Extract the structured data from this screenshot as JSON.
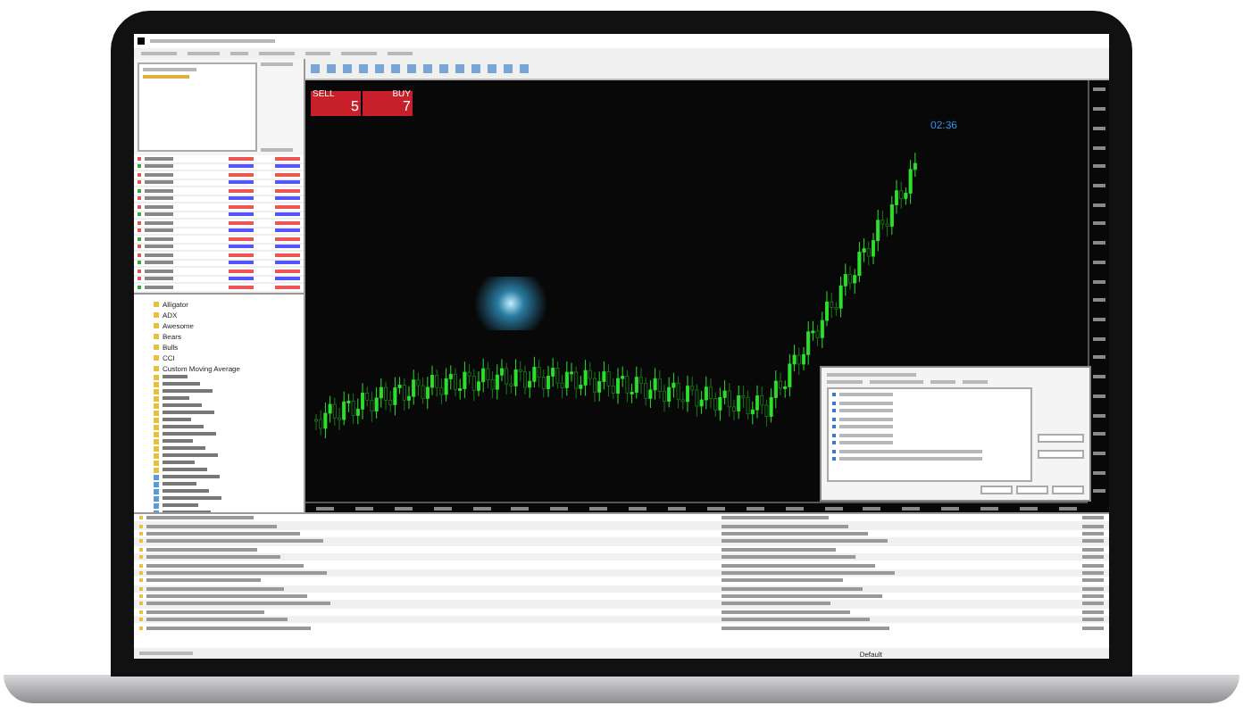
{
  "order_panel": {
    "sell_label": "SELL",
    "buy_label": "BUY",
    "sell_price": "5",
    "buy_price": "7"
  },
  "chart": {
    "time_label": "02:36"
  },
  "navigator": {
    "items": [
      "Alligator",
      "ADX",
      "Awesome",
      "Bears",
      "Bulls",
      "CCI",
      "Custom Moving Average"
    ]
  },
  "status_bar": {
    "profile": "Default"
  }
}
